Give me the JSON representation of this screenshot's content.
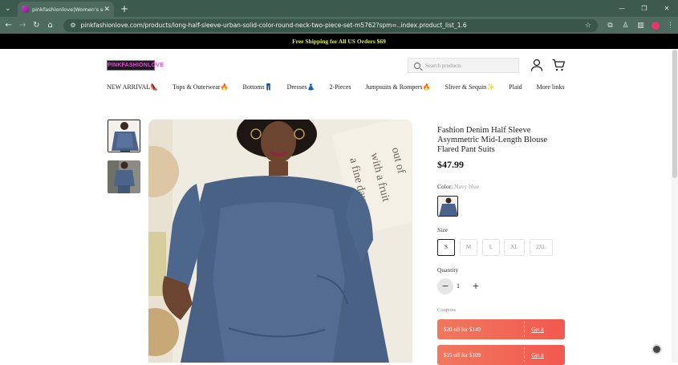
{
  "browser": {
    "tab_title": "pinkfashionlove|Women's sel",
    "url": "pinkfashionlove.com/products/long-half-sleeve-urban-solid-color-round-neck-two-piece-set-m5762?spm=..index.product_list_1.6"
  },
  "announcement": "Free Shipping for All US Orders $69",
  "header": {
    "logo_text": "PINKFASHIONLOVE",
    "search_placeholder": "Search products"
  },
  "menu": [
    "NEW ARRIVAL👠",
    "Tops & Outerwear🔥",
    "Bottoms👖",
    "Dresses👗",
    "2-Pieces",
    "Jumpsuits & Rompers🔥",
    "Sliver & Sequin✨",
    "Plaid",
    "More links"
  ],
  "product": {
    "title": "Fashion Denim Half Sleeve Asymmetric Mid-Length Blouse Flared Pant Suits",
    "price": "$47.99",
    "color_label": "Color:",
    "color_value": "Navy blue",
    "size_label": "Size",
    "sizes": [
      "S",
      "M",
      "L",
      "XL",
      "2XL"
    ],
    "selected_size": "S",
    "quantity_label": "Quantity",
    "quantity": "1",
    "coupons_label": "Coupons",
    "coupons": [
      {
        "desc": "$20 off for $149",
        "action": "Get it"
      },
      {
        "desc": "$15 off for $109",
        "action": "Get it"
      }
    ]
  }
}
